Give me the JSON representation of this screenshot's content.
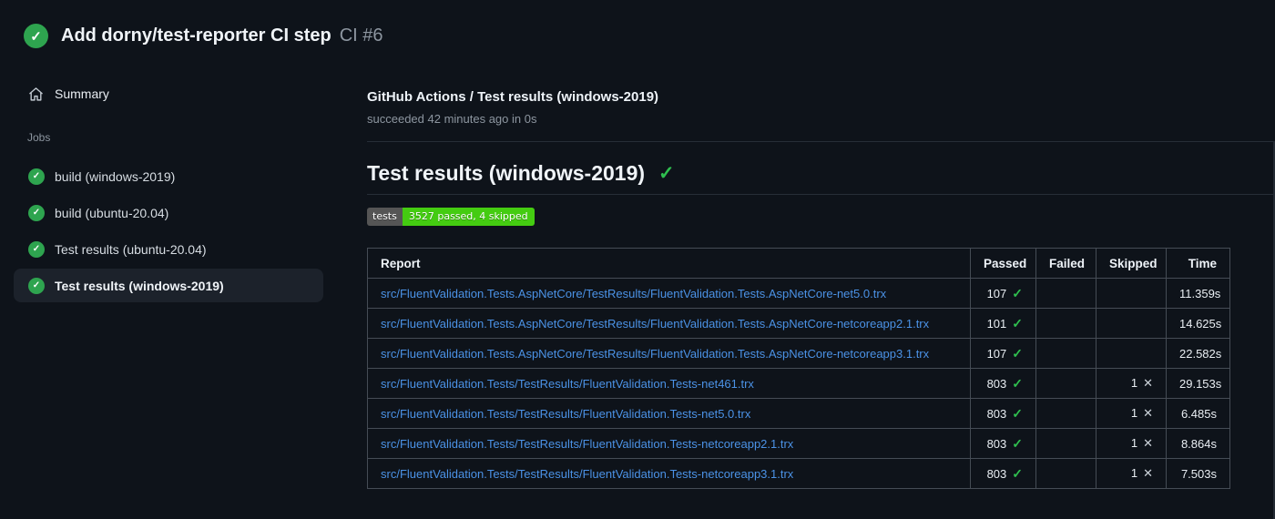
{
  "icons": {
    "check": "✓",
    "cross": "✕"
  },
  "colors": {
    "background": "#0e131a",
    "success_green": "#2ea44f",
    "check_green": "#2fbf4f",
    "link_blue": "#4b92e6",
    "badge_label_bg": "#555555",
    "badge_message_bg": "#44cc11",
    "selected_item_bg": "#1c222b",
    "table_border": "#454c55"
  },
  "header": {
    "title": "Add dorny/test-reporter CI step",
    "run_number": "CI #6"
  },
  "sidebar": {
    "summary_label": "Summary",
    "jobs_label": "Jobs",
    "jobs": [
      {
        "label": "build (windows-2019)"
      },
      {
        "label": "build (ubuntu-20.04)"
      },
      {
        "label": "Test results (ubuntu-20.04)"
      },
      {
        "label": "Test results (windows-2019)",
        "selected": true
      }
    ]
  },
  "main": {
    "check_title": "GitHub Actions / Test results (windows-2019)",
    "check_subtitle": "succeeded 42 minutes ago in 0s",
    "section_heading": "Test results (windows-2019)",
    "badge": {
      "label": "tests",
      "message": "3527 passed, 4 skipped"
    },
    "table": {
      "columns": [
        "Report",
        "Passed",
        "Failed",
        "Skipped",
        "Time"
      ],
      "rows": [
        {
          "report": "src/FluentValidation.Tests.AspNetCore/TestResults/FluentValidation.Tests.AspNetCore-net5.0.trx",
          "passed": "107",
          "passed_icon": "✓",
          "failed": "",
          "skipped": "",
          "skipped_icon": "",
          "time": "11.359s"
        },
        {
          "report": "src/FluentValidation.Tests.AspNetCore/TestResults/FluentValidation.Tests.AspNetCore-netcoreapp2.1.trx",
          "passed": "101",
          "passed_icon": "✓",
          "failed": "",
          "skipped": "",
          "skipped_icon": "",
          "time": "14.625s"
        },
        {
          "report": "src/FluentValidation.Tests.AspNetCore/TestResults/FluentValidation.Tests.AspNetCore-netcoreapp3.1.trx",
          "passed": "107",
          "passed_icon": "✓",
          "failed": "",
          "skipped": "",
          "skipped_icon": "",
          "time": "22.582s"
        },
        {
          "report": "src/FluentValidation.Tests/TestResults/FluentValidation.Tests-net461.trx",
          "passed": "803",
          "passed_icon": "✓",
          "failed": "",
          "skipped": "1",
          "skipped_icon": "✕",
          "time": "29.153s"
        },
        {
          "report": "src/FluentValidation.Tests/TestResults/FluentValidation.Tests-net5.0.trx",
          "passed": "803",
          "passed_icon": "✓",
          "failed": "",
          "skipped": "1",
          "skipped_icon": "✕",
          "time": "6.485s"
        },
        {
          "report": "src/FluentValidation.Tests/TestResults/FluentValidation.Tests-netcoreapp2.1.trx",
          "passed": "803",
          "passed_icon": "✓",
          "failed": "",
          "skipped": "1",
          "skipped_icon": "✕",
          "time": "8.864s"
        },
        {
          "report": "src/FluentValidation.Tests/TestResults/FluentValidation.Tests-netcoreapp3.1.trx",
          "passed": "803",
          "passed_icon": "✓",
          "failed": "",
          "skipped": "1",
          "skipped_icon": "✕",
          "time": "7.503s"
        }
      ]
    }
  }
}
